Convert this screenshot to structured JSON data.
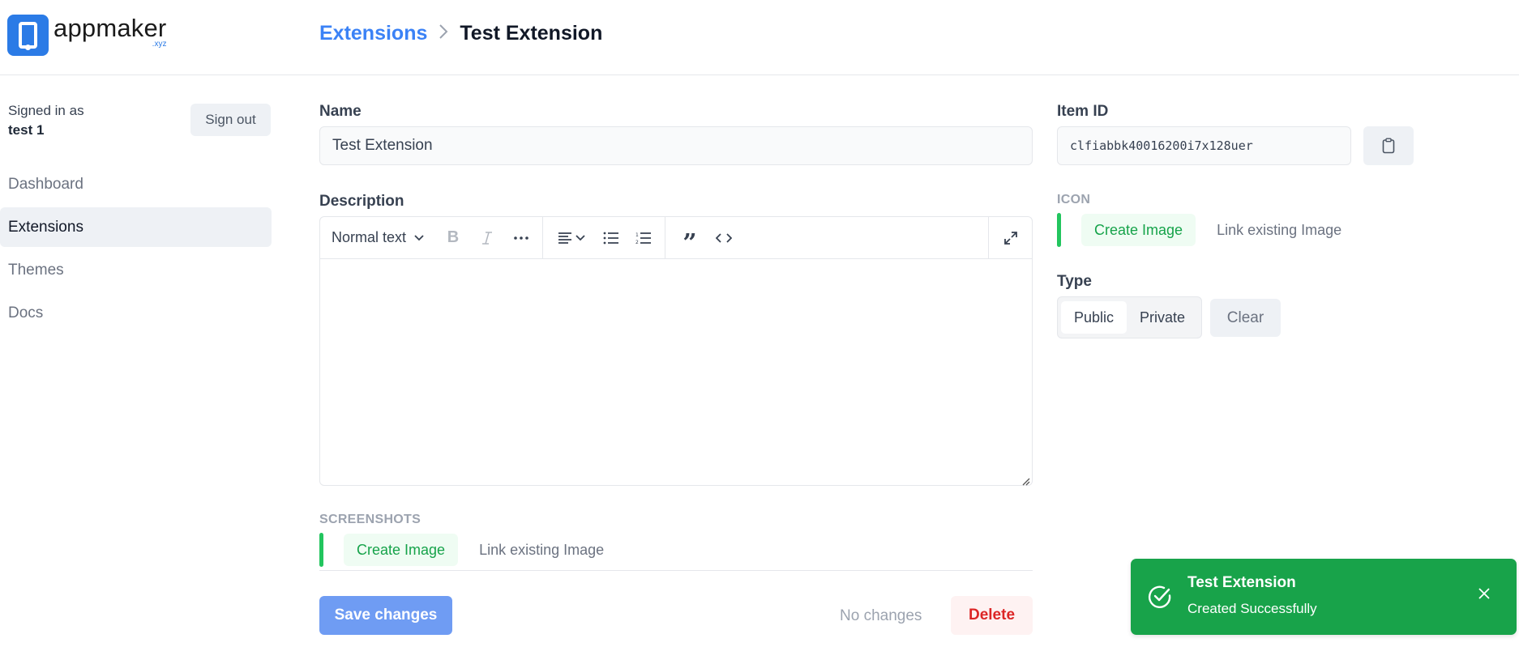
{
  "app": {
    "logo_name": "appmaker",
    "logo_tld": ".xyz",
    "brand_color": "#2b7be6"
  },
  "breadcrumb": {
    "parent": "Extensions",
    "separator_icon": "chevron-right-icon",
    "current": "Test Extension"
  },
  "sidebar": {
    "signed_in_label": "Signed in as",
    "username": "test 1",
    "sign_out_label": "Sign out",
    "items": [
      {
        "label": "Dashboard",
        "active": false
      },
      {
        "label": "Extensions",
        "active": true
      },
      {
        "label": "Themes",
        "active": false
      },
      {
        "label": "Docs",
        "active": false
      }
    ]
  },
  "form": {
    "name_label": "Name",
    "name_value": "Test Extension",
    "description_label": "Description",
    "editor": {
      "block_type": "Normal text",
      "toolbar_icons": [
        "chevron-down-icon",
        "bold-icon",
        "italic-icon",
        "more-icon",
        "align-left-icon",
        "bullet-list-icon",
        "numbered-list-icon",
        "quote-icon",
        "code-icon",
        "expand-icon"
      ],
      "content": ""
    },
    "screenshots_label": "SCREENSHOTS",
    "screenshots_create_label": "Create Image",
    "screenshots_link_label": "Link existing Image",
    "save_label": "Save changes",
    "status_text": "No changes",
    "delete_label": "Delete"
  },
  "side_panel": {
    "item_id_label": "Item ID",
    "item_id_value": "clfiabbk40016200i7x128uer",
    "copy_icon": "clipboard-icon",
    "icon_label": "ICON",
    "icon_create_label": "Create Image",
    "icon_link_label": "Link existing Image",
    "type_label": "Type",
    "type_options": [
      "Public",
      "Private"
    ],
    "type_selected": "Public",
    "clear_label": "Clear"
  },
  "toast": {
    "title": "Test Extension",
    "message": "Created Successfully",
    "color": "#18a34a"
  }
}
